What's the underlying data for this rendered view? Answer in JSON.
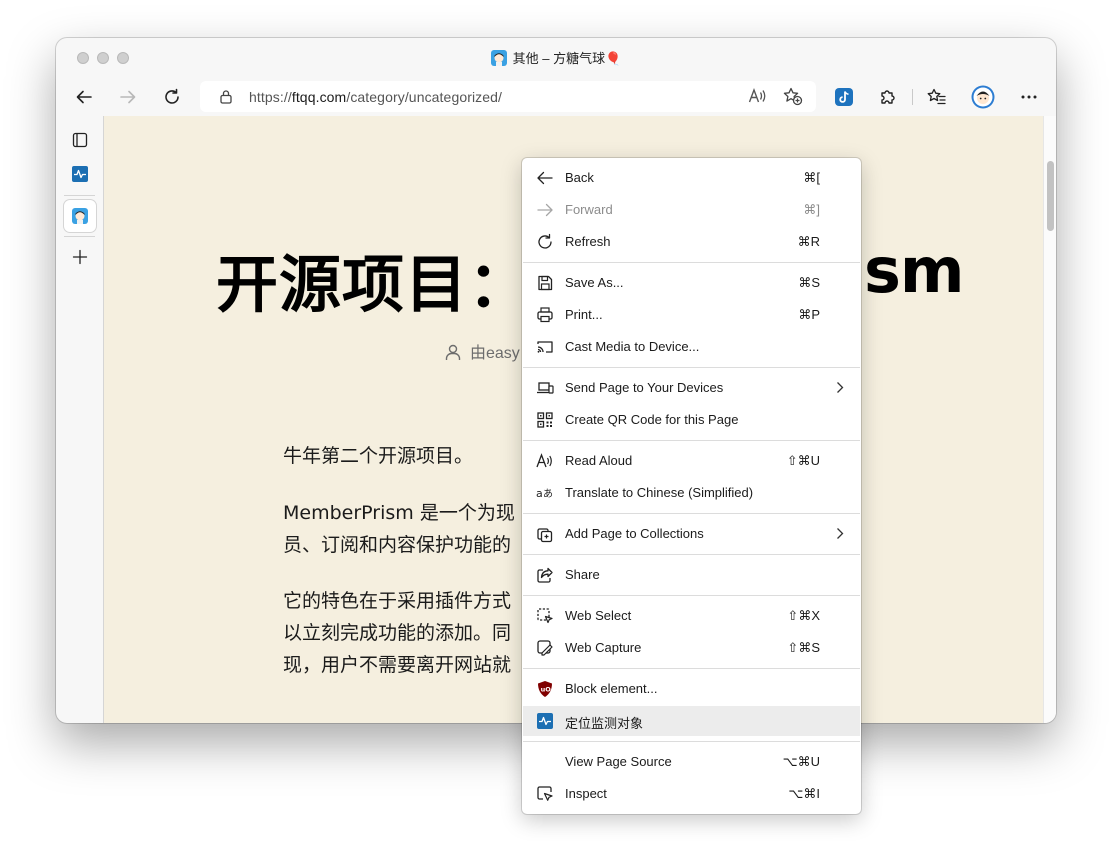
{
  "window": {
    "title": "其他 – 方糖气球🎈"
  },
  "toolbar": {
    "url_scheme": "https://",
    "url_host": "ftqq.com",
    "url_path": "/category/uncategorized/"
  },
  "article": {
    "title_left": "开源项目：",
    "title_right": "sm",
    "byline": "由easy",
    "p1": "牛年第二个开源项目。",
    "p2_line1": "MemberPrism 是一个为现",
    "p2_line2": "员、订阅和内容保护功能的",
    "p3_line1": "它的特色在于采用插件方式",
    "p3_line2": "以立刻完成功能的添加。同",
    "p3_line3": "现，用户不需要离开网站就"
  },
  "context_menu": {
    "items": [
      {
        "label": "Back",
        "shortcut": "⌘[",
        "icon": "arrow-left-icon"
      },
      {
        "label": "Forward",
        "shortcut": "⌘]",
        "icon": "arrow-right-icon",
        "disabled": true
      },
      {
        "label": "Refresh",
        "shortcut": "⌘R",
        "icon": "refresh-icon"
      },
      {
        "label": "Save As...",
        "shortcut": "⌘S",
        "icon": "save-icon"
      },
      {
        "label": "Print...",
        "shortcut": "⌘P",
        "icon": "print-icon"
      },
      {
        "label": "Cast Media to Device...",
        "shortcut": "",
        "icon": "cast-icon"
      },
      {
        "label": "Send Page to Your Devices",
        "shortcut": "",
        "icon": "devices-icon",
        "submenu": true
      },
      {
        "label": "Create QR Code for this Page",
        "shortcut": "",
        "icon": "qr-code-icon"
      },
      {
        "label": "Read Aloud",
        "shortcut": "⇧⌘U",
        "icon": "read-aloud-icon"
      },
      {
        "label": "Translate to Chinese (Simplified)",
        "shortcut": "",
        "icon": "translate-icon"
      },
      {
        "label": "Add Page to Collections",
        "shortcut": "",
        "icon": "collections-icon",
        "submenu": true
      },
      {
        "label": "Share",
        "shortcut": "",
        "icon": "share-icon"
      },
      {
        "label": "Web Select",
        "shortcut": "⇧⌘X",
        "icon": "web-select-icon"
      },
      {
        "label": "Web Capture",
        "shortcut": "⇧⌘S",
        "icon": "web-capture-icon"
      },
      {
        "label": "Block element...",
        "shortcut": "",
        "icon": "ublock-icon"
      },
      {
        "label": "定位监测对象",
        "shortcut": "",
        "icon": "monitor-pulse-icon",
        "highlighted": true
      },
      {
        "label": "View Page Source",
        "shortcut": "⌥⌘U",
        "icon": ""
      },
      {
        "label": "Inspect",
        "shortcut": "⌥⌘I",
        "icon": "inspect-icon"
      }
    ]
  },
  "colors": {
    "page_background": "#f5efdf",
    "menu_highlight": "#ececec",
    "ublock_red": "#800000",
    "accent_blue": "#1e73be"
  }
}
